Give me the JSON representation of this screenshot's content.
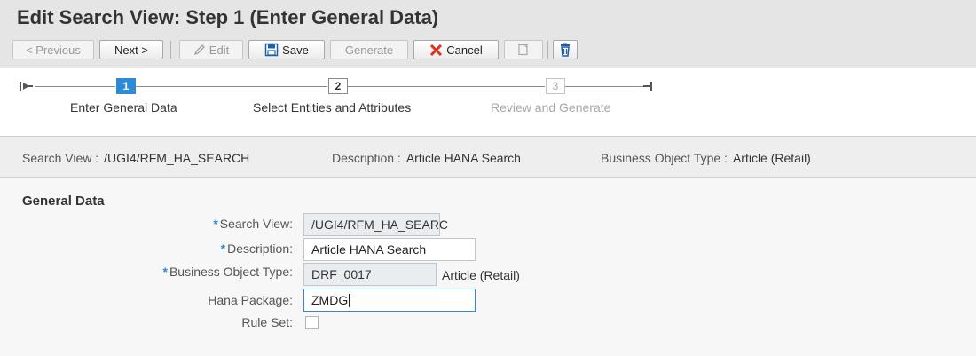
{
  "page_title": "Edit Search View: Step 1  (Enter General Data)",
  "toolbar": {
    "previous": "< Previous",
    "next": "Next >",
    "edit": "Edit",
    "save": "Save",
    "generate": "Generate",
    "cancel": "Cancel"
  },
  "roadmap": {
    "steps": [
      {
        "number": "1",
        "label": "Enter General Data",
        "state": "active"
      },
      {
        "number": "2",
        "label": "Select Entities and Attributes",
        "state": "enabled"
      },
      {
        "number": "3",
        "label": "Review and Generate",
        "state": "disabled"
      }
    ]
  },
  "summary": {
    "search_view_label": "Search View :",
    "search_view_value": "/UGI4/RFM_HA_SEARCH",
    "description_label": "Description :",
    "description_value": "Article HANA Search",
    "bo_type_label": "Business Object Type :",
    "bo_type_value": "Article (Retail)"
  },
  "form": {
    "section_title": "General Data",
    "search_view": {
      "label": "Search View:",
      "value": "/UGI4/RFM_HA_SEARC",
      "required": true
    },
    "description": {
      "label": "Description:",
      "value": "Article HANA Search",
      "required": true
    },
    "bo_type": {
      "label": "Business Object Type:",
      "value": "DRF_0017",
      "text": "Article (Retail)",
      "required": true
    },
    "hana_package": {
      "label": "Hana Package:",
      "value": "ZMDG"
    },
    "rule_set": {
      "label": "Rule Set:",
      "checked": false
    }
  },
  "colors": {
    "accent": "#2c8ad6",
    "step_active": "#2c8ad6",
    "cancel_icon": "#e0301e",
    "header_bg": "#e5e5e5"
  }
}
